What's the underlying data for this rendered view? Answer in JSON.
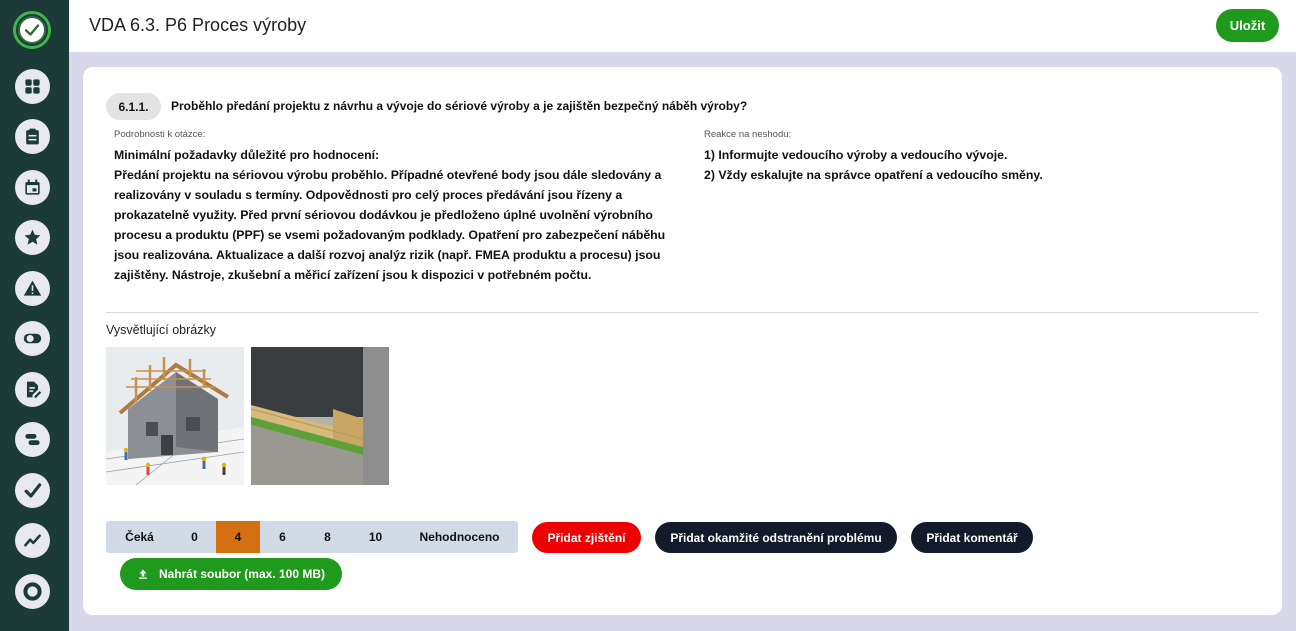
{
  "header": {
    "title": "VDA 6.3. P6 Proces výroby",
    "save_label": "Uložit"
  },
  "sidebar": {
    "items": [
      {
        "icon": "dashboard-icon"
      },
      {
        "icon": "clipboard-icon"
      },
      {
        "icon": "calendar-icon"
      },
      {
        "icon": "star-icon"
      },
      {
        "icon": "warning-icon"
      },
      {
        "icon": "toggle-icon"
      },
      {
        "icon": "edit-document-icon"
      },
      {
        "icon": "timeline-icon"
      },
      {
        "icon": "check-icon"
      },
      {
        "icon": "trend-icon"
      },
      {
        "icon": "lifebuoy-icon"
      }
    ]
  },
  "question": {
    "number": "6.1.1.",
    "text": "Proběhlo předání projektu z návrhu a vývoje do sériové výroby a je zajištěn bezpečný náběh výroby?",
    "details_label": "Podrobnosti k otázce:",
    "details_heading": "Minimální požadavky důležité pro hodnocení:",
    "details_body": "Předání projektu na sériovou výrobu proběhlo. Případné otevřené body jsou dále sledovány a realizovány v souladu s termíny. Odpovědnosti pro celý proces předávání jsou řízeny a prokazatelně využity. Před první sériovou dodávkou je předloženo úplné uvolnění výrobního procesu a produktu (PPF) se vsemi požadovaným podklady. Opatření pro zabezpečení náběhu jsou realizována. Aktualizace a další rozvoj analýz rizik (např. FMEA produktu a procesu) jsou zajištěny. Nástroje, zkušební a měřicí zařízení jsou k dispozici v potřebném počtu.",
    "reaction_label": "Reakce na neshodu:",
    "reaction_lines": [
      "1) Informujte vedoucího výroby a vedoucího vývoje.",
      "2) Vždy eskalujte na správce opatření a vedoucího směny."
    ]
  },
  "images": {
    "label": "Vysvětlující obrázky"
  },
  "rating": {
    "options": [
      "Čeká",
      "0",
      "4",
      "6",
      "8",
      "10",
      "Nehodnoceno"
    ],
    "selected": "4"
  },
  "actions": {
    "add_finding": "Přidat zjištění",
    "add_immediate_fix": "Přidat okamžité odstranění problému",
    "add_comment": "Přidat komentář",
    "upload": "Nahrát soubor (max. 100 MB)"
  },
  "colors": {
    "sidebar": "#1c3a38",
    "accent_green": "#1f9a1d",
    "selected_rating": "#d47011",
    "danger": "#ef0000",
    "dark_button": "#111b2b"
  }
}
